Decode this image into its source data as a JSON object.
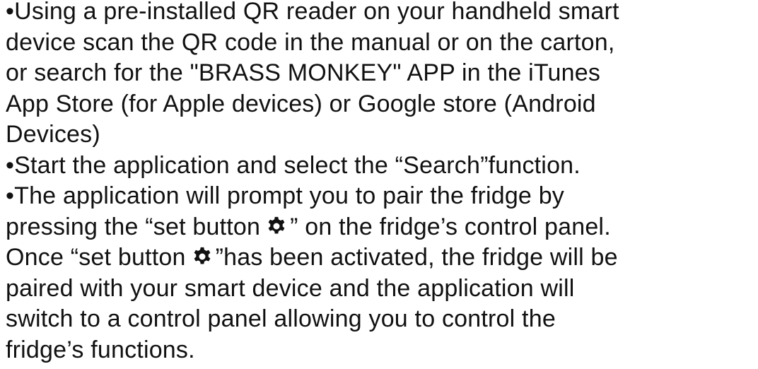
{
  "document": {
    "bullet": "•",
    "item1": {
      "lines": [
        "Using a pre-installed QR reader on your handheld smart",
        "device scan the QR code in the manual or on the carton,",
        "or search for the \"BRASS MONKEY\" APP in the iTunes",
        "App Store (for Apple devices) or Google store (Android",
        "Devices)"
      ]
    },
    "item2": {
      "line": "Start the application and select the “Search”function."
    },
    "item3": {
      "line1": "The application will prompt you to pair the fridge by",
      "line2_before": "pressing the “set button",
      "line2_after": "” on the fridge’s control panel.",
      "line3_before": "Once “set button",
      "line3_after": "”has been activated, the fridge will be",
      "line4": "paired with your smart device and the application will",
      "line5": "switch to a control panel allowing you to control the",
      "line6": "fridge’s functions."
    },
    "icon": "gear-icon",
    "text_color": "#111111"
  }
}
